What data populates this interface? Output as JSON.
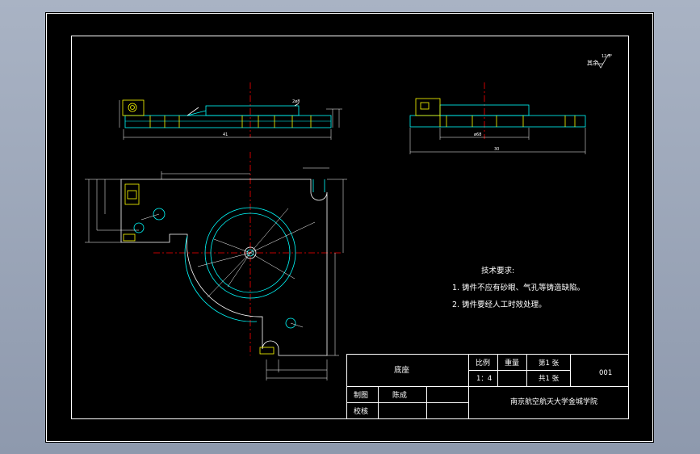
{
  "drawing": {
    "surface_finish": {
      "label": "其余",
      "value": "12.5"
    },
    "tech_requirements": {
      "heading": "技术要求:",
      "items": [
        "1. 铸件不应有砂眼、气孔等铸造缺陷。",
        "2. 铸件要经人工时效处理。"
      ]
    },
    "title_block": {
      "part_name": "底座",
      "scale_label": "比例",
      "scale_value": "1：4",
      "weight_label": "重量",
      "sheet_label": "第1 张",
      "total_label": "共1 张",
      "drawing_no": "001",
      "drawn_by_label": "制图",
      "drawn_by_name": "陈成",
      "checked_label": "校核",
      "organization": "南京航空航天大学金城学院"
    },
    "dimensions": {
      "top_view_length": "41",
      "side_view_length": "30",
      "side_view_inner": "ø68",
      "top_view_hole_note": "2ø8"
    },
    "colors": {
      "background": "#000000",
      "outline": "#ffffff",
      "part": "#00ffff",
      "center_line": "#ff0000",
      "text": "#ffffff"
    }
  }
}
